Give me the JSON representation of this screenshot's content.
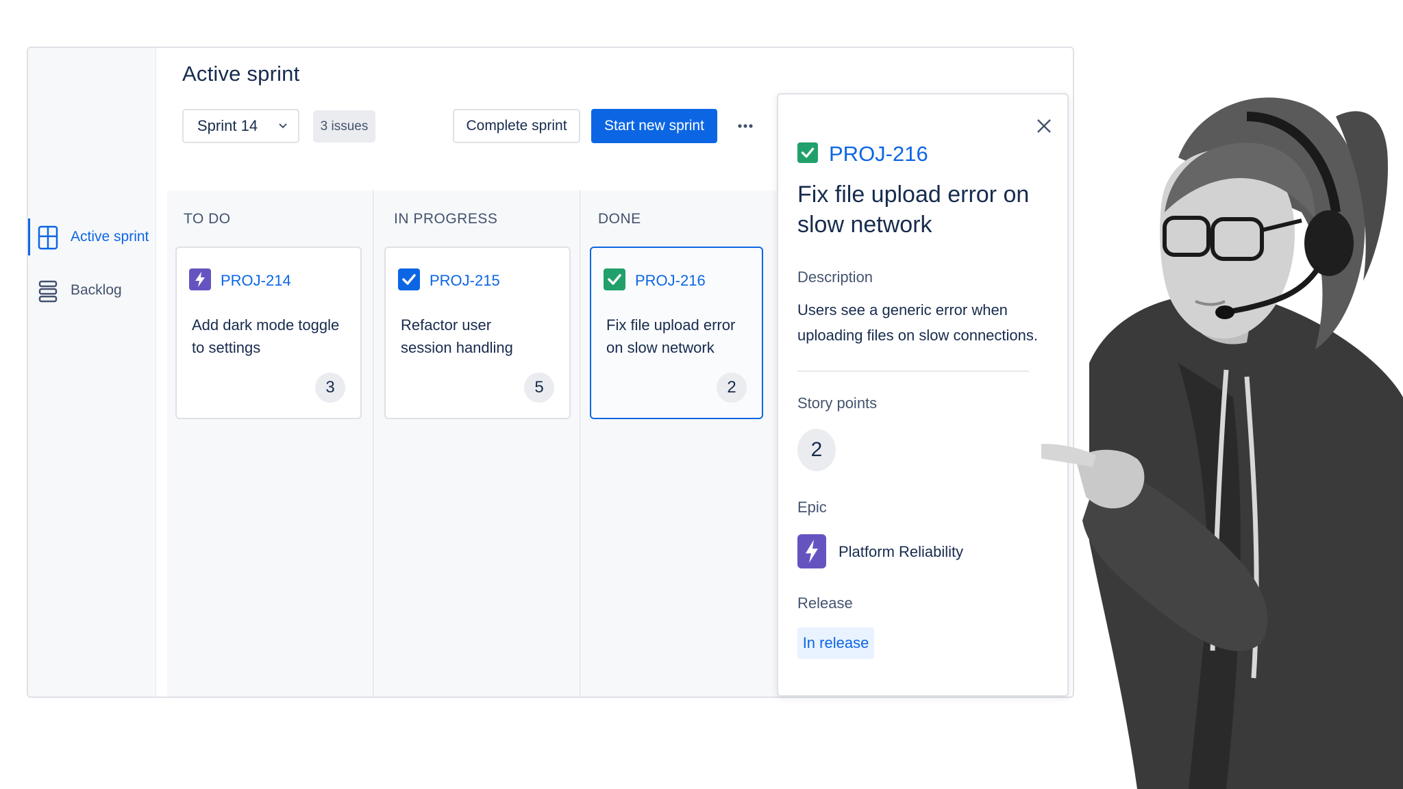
{
  "sidebar": {
    "items": [
      {
        "label": "Active sprint",
        "icon": "board-icon",
        "active": true
      },
      {
        "label": "Backlog",
        "icon": "backlog-icon",
        "active": false
      }
    ]
  },
  "header": {
    "title": "Active sprint",
    "sprint_select": "Sprint 14",
    "issues_badge": "3 issues",
    "complete_label": "Complete sprint",
    "start_label": "Start new sprint",
    "more_icon": "more-horizontal-icon"
  },
  "board": {
    "columns": [
      {
        "title": "TO DO",
        "card": {
          "key": "PROJ-214",
          "type": "epic",
          "summary_line1": "Add dark mode toggle",
          "summary_line2": "to settings",
          "points": "3"
        }
      },
      {
        "title": "IN PROGRESS",
        "card": {
          "key": "PROJ-215",
          "type": "task",
          "summary_line1": "Refactor user",
          "summary_line2": "session handling",
          "points": "5"
        }
      },
      {
        "title": "DONE",
        "card": {
          "key": "PROJ-216",
          "type": "done",
          "summary_line1": "Fix file upload error",
          "summary_line2": "on slow network",
          "points": "2"
        }
      }
    ]
  },
  "detail": {
    "key": "PROJ-216",
    "title": "Fix file upload error on slow network",
    "description_label": "Description",
    "description": "Users see a generic error when uploading files on slow connections.",
    "story_points_label": "Story points",
    "story_points": "2",
    "epic_label": "Epic",
    "epic_name": "Platform Reliability",
    "release_label": "Release",
    "release_value": "In release"
  },
  "colors": {
    "accent": "#0c66e4",
    "epic_purple": "#6554c0",
    "done_green": "#22a06b",
    "text": "#172b4d"
  }
}
